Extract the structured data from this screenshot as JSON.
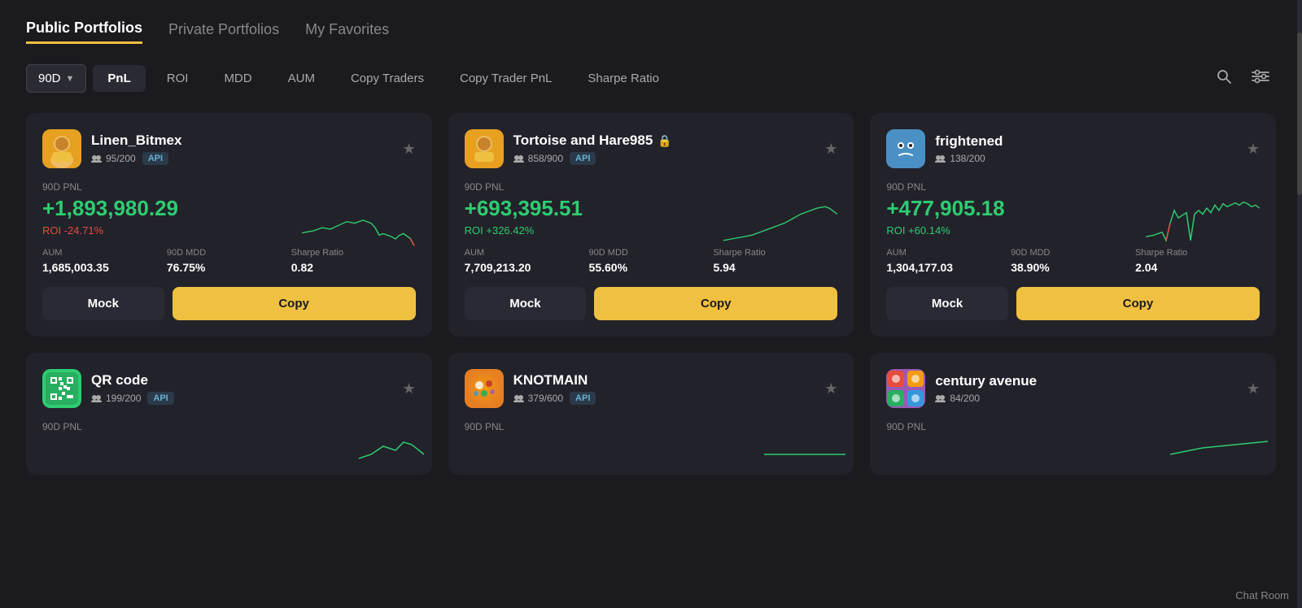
{
  "topTabs": [
    {
      "id": "public",
      "label": "Public Portfolios",
      "active": true
    },
    {
      "id": "private",
      "label": "Private Portfolios",
      "active": false
    },
    {
      "id": "favorites",
      "label": "My Favorites",
      "active": false
    }
  ],
  "filterBar": {
    "period": "90D",
    "periodArrow": "▼",
    "filters": [
      {
        "id": "pnl",
        "label": "PnL",
        "active": true
      },
      {
        "id": "roi",
        "label": "ROI",
        "active": false
      },
      {
        "id": "mdd",
        "label": "MDD",
        "active": false
      },
      {
        "id": "aum",
        "label": "AUM",
        "active": false
      },
      {
        "id": "copy-traders",
        "label": "Copy Traders",
        "active": false
      },
      {
        "id": "copy-trader-pnl",
        "label": "Copy Trader PnL",
        "active": false
      },
      {
        "id": "sharpe-ratio",
        "label": "Sharpe Ratio",
        "active": false
      }
    ]
  },
  "cards": [
    {
      "id": "linen-bitmex",
      "name": "Linen_Bitmex",
      "avatarEmoji": "😐",
      "avatarClass": "avatar-linen",
      "followers": "95/200",
      "hasApi": true,
      "hasLock": false,
      "pnlLabel": "90D PNL",
      "pnlValue": "+1,893,980.29",
      "pnlPositive": true,
      "roi": "ROI -24.71%",
      "roiPositive": false,
      "aumLabel": "AUM",
      "aumValue": "1,685,003.35",
      "mddLabel": "90D MDD",
      "mddValue": "76.75%",
      "sharpeLabel": "Sharpe Ratio",
      "sharpeValue": "0.82",
      "mockLabel": "Mock",
      "copyLabel": "Copy",
      "chartColor": "#2ecc71",
      "chartPoints": "0,45 15,42 25,38 35,40 45,35 55,30 65,32 75,28 85,35 90,42 95,50 100,48 110,52 115,55 120,50 125,48 130,52 135,55 140,60"
    },
    {
      "id": "tortoise-hare",
      "name": "Tortoise and Hare985",
      "avatarEmoji": "😐",
      "avatarClass": "avatar-tortoise",
      "followers": "858/900",
      "hasApi": true,
      "hasLock": true,
      "pnlLabel": "90D PNL",
      "pnlValue": "+693,395.51",
      "pnlPositive": true,
      "roi": "ROI +326.42%",
      "roiPositive": true,
      "aumLabel": "AUM",
      "aumValue": "7,709,213.20",
      "mddLabel": "90D MDD",
      "mddValue": "55.60%",
      "sharpeLabel": "Sharpe Ratio",
      "sharpeValue": "5.94",
      "mockLabel": "Mock",
      "copyLabel": "Copy",
      "chartColor": "#2ecc71",
      "chartPoints": "0,55 15,52 25,50 35,48 45,44 55,40 65,36 75,32 85,28 90,25 95,22 100,20 110,18 115,20 120,25 125,28 130,32 135,35 140,40"
    },
    {
      "id": "frightened",
      "name": "frightened",
      "avatarEmoji": "🤖",
      "avatarClass": "avatar-frightened",
      "followers": "138/200",
      "hasApi": false,
      "hasLock": false,
      "pnlLabel": "90D PNL",
      "pnlValue": "+477,905.18",
      "pnlPositive": true,
      "roi": "ROI +60.14%",
      "roiPositive": true,
      "aumLabel": "AUM",
      "aumValue": "1,304,177.03",
      "mddLabel": "90D MDD",
      "mddValue": "38.90%",
      "sharpeLabel": "Sharpe Ratio",
      "sharpeValue": "2.04",
      "mockLabel": "Mock",
      "copyLabel": "Copy",
      "chartColor": "#2ecc71",
      "chartPoints": "0,50 15,48 25,45 35,42 40,50 45,35 50,20 55,30 65,22 75,18 80,22 85,18 90,15 95,18 100,12 110,15 120,10 130,8 140,12"
    }
  ],
  "bottomCards": [
    {
      "id": "qr-code",
      "name": "QR code",
      "avatarEmoji": "🟩",
      "avatarClass": "avatar-qr",
      "followers": "199/200",
      "hasApi": true,
      "pnlLabel": "90D PNL",
      "chartColor": "#2ecc71",
      "chartPoints": "0,50 20,48 40,45 60,42 80,40 100,42 120,38 140,35"
    },
    {
      "id": "knotmain",
      "name": "KNOTMAIN",
      "avatarEmoji": "🎨",
      "avatarClass": "avatar-knotmain",
      "followers": "379/600",
      "hasApi": true,
      "pnlLabel": "90D PNL",
      "chartColor": "#2ecc71",
      "chartPoints": "0,50 20,50 40,50 60,50 80,50 100,50 120,50 140,50"
    },
    {
      "id": "century-avenue",
      "name": "century avenue",
      "avatarEmoji": "🏙️",
      "avatarClass": "avatar-century",
      "followers": "84/200",
      "hasApi": false,
      "pnlLabel": "90D PNL",
      "chartColor": "#2ecc71",
      "chartPoints": "0,50 20,45 40,42 60,40 80,38 100,36 120,35 140,34"
    }
  ],
  "icons": {
    "search": "🔍",
    "filter": "⚙",
    "star": "★",
    "people": "👥",
    "lock": "🔒"
  },
  "chatRoom": {
    "label": "Chat Room"
  }
}
